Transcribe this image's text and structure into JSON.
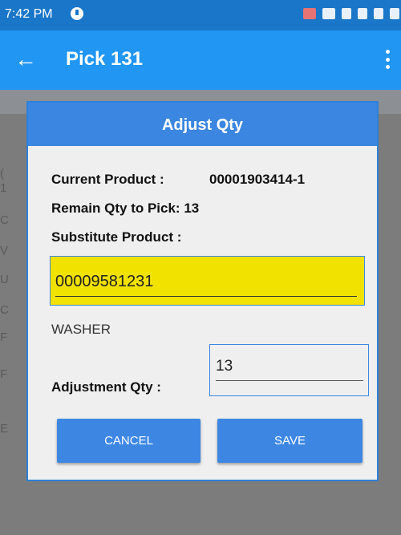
{
  "status_bar": {
    "time": "7:42 PM"
  },
  "app_bar": {
    "title": "Pick 131"
  },
  "background_letters": [
    "(",
    "1",
    "C",
    "V",
    "U",
    "C",
    "F",
    "F",
    "E"
  ],
  "dialog": {
    "title": "Adjust Qty",
    "current_product_label": "Current Product :",
    "current_product_value": "00001903414-1",
    "remain_qty_text": "Remain Qty to Pick: 13",
    "substitute_label": "Substitute Product :",
    "substitute_value": "00009581231",
    "product_description": "WASHER",
    "adjustment_label": "Adjustment Qty :",
    "adjustment_value": "13",
    "cancel_label": "CANCEL",
    "save_label": "SAVE",
    "highlight_color": "#f2e200",
    "accent_color": "#3a86e0"
  }
}
